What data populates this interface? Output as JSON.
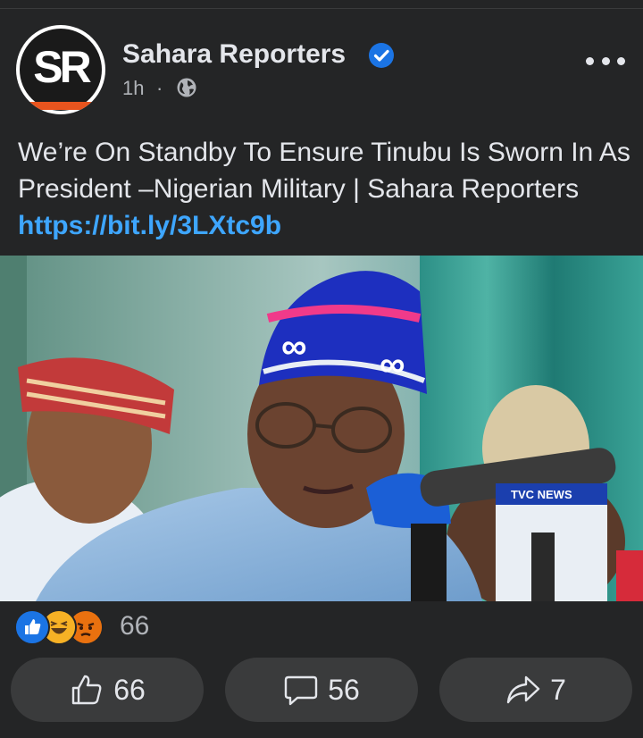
{
  "post": {
    "page_name": "Sahara Reporters",
    "avatar_initials": "SR",
    "time": "1h",
    "separator": "·",
    "caption_text": "We’re On Standby To Ensure Tinubu Is Sworn In As President –Nigerian Military | Sahara Reporters ",
    "caption_link": "https://bit.ly/3LXtc9b",
    "photo_badge": "TVC NEWS"
  },
  "reactions": {
    "icons": [
      "like-icon",
      "haha-icon",
      "angry-icon"
    ],
    "count": "66"
  },
  "actions": {
    "like_count": "66",
    "comment_count": "56",
    "share_count": "7"
  },
  "colors": {
    "background": "#242526",
    "button": "#3a3b3c",
    "link": "#3ea6ff",
    "verified": "#1b74e4",
    "brand_orange": "#e8541e"
  }
}
